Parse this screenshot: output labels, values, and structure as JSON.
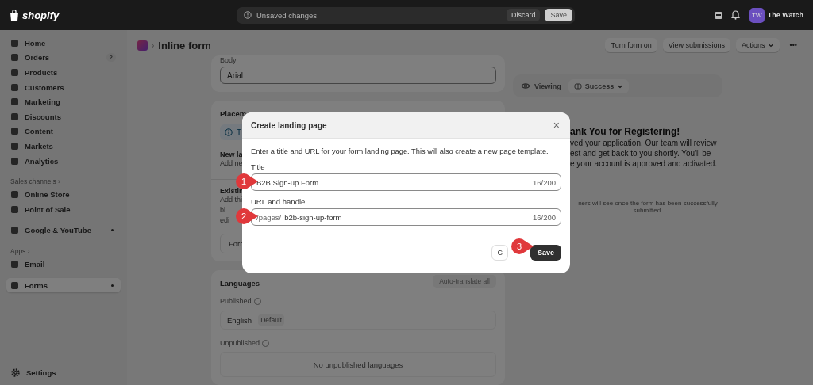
{
  "topbar": {
    "logo": "shopify",
    "notice": "Unsaved changes",
    "discard": "Discard",
    "save": "Save",
    "avatar": "TW",
    "store": "The Watch"
  },
  "sidebar": {
    "groups": [
      {
        "items": [
          {
            "label": "Home",
            "selected": false,
            "pinned": false
          },
          {
            "label": "Orders",
            "selected": false,
            "pinned": false,
            "badge": "2"
          },
          {
            "label": "Products",
            "selected": false,
            "pinned": false
          },
          {
            "label": "Customers",
            "selected": false,
            "pinned": false
          },
          {
            "label": "Marketing",
            "selected": false,
            "pinned": false
          },
          {
            "label": "Discounts",
            "selected": false,
            "pinned": false
          },
          {
            "label": "Content",
            "selected": false,
            "pinned": false
          },
          {
            "label": "Markets",
            "selected": false,
            "pinned": false
          },
          {
            "label": "Analytics",
            "selected": false,
            "pinned": false
          }
        ]
      },
      {
        "heading": "Sales channels",
        "chevron": "›",
        "items": [
          {
            "label": "Online Store",
            "selected": false,
            "pinned": false
          },
          {
            "label": "Point of Sale",
            "selected": false,
            "pinned": false
          }
        ]
      },
      {
        "items": [
          {
            "label": "Google & YouTube",
            "selected": false,
            "pinned": true
          }
        ]
      },
      {
        "heading": "Apps",
        "chevron": "›",
        "items": [
          {
            "label": "Email",
            "selected": false,
            "pinned": false
          }
        ]
      },
      {
        "items": [
          {
            "label": "Forms",
            "selected": true,
            "pinned": true
          }
        ]
      }
    ],
    "settings": "Settings"
  },
  "header": {
    "separator": "›",
    "title": "Inline form",
    "buttons": [
      "Turn form on",
      "View submissions",
      "Actions"
    ],
    "more": "•••"
  },
  "body_card": {
    "label": "Body",
    "value": "Arial"
  },
  "placement_card": {
    "title": "Placem",
    "banner": "T",
    "new_title": "New la",
    "new_text": "Add ne",
    "existing_title": "Existin",
    "existing_lines": [
      "Add thi",
      "bl",
      "edi"
    ],
    "button": "Forr"
  },
  "languages_card": {
    "title": "Languages",
    "button": "Auto-translate all",
    "published": "Published",
    "language": "English",
    "language_badge": "Default",
    "unpublished": "Unpublished",
    "empty": "No unpublished languages"
  },
  "preview": {
    "viewing": "Viewing",
    "state": "Success",
    "heading": "ank You for Registering!",
    "lines": [
      "ved your application. Our team will review",
      "est and get back to you shortly. You'll be",
      "e your account is approved and activated."
    ],
    "note": "ners will see once the form has been successfully submitted."
  },
  "modal": {
    "title": "Create landing page",
    "close": "×",
    "description": "Enter a title and URL for your form landing page. This will also create a new page template.",
    "fields": [
      {
        "label": "Title",
        "value": "B2B Sign-up Form",
        "counter": "16/200",
        "marker": "1"
      },
      {
        "label": "URL and handle",
        "prefix": "/pages/",
        "value": "b2b-sign-up-form",
        "counter": "16/200",
        "marker": "2"
      }
    ],
    "cancel": "C",
    "save": "Save",
    "save_marker": "3"
  }
}
